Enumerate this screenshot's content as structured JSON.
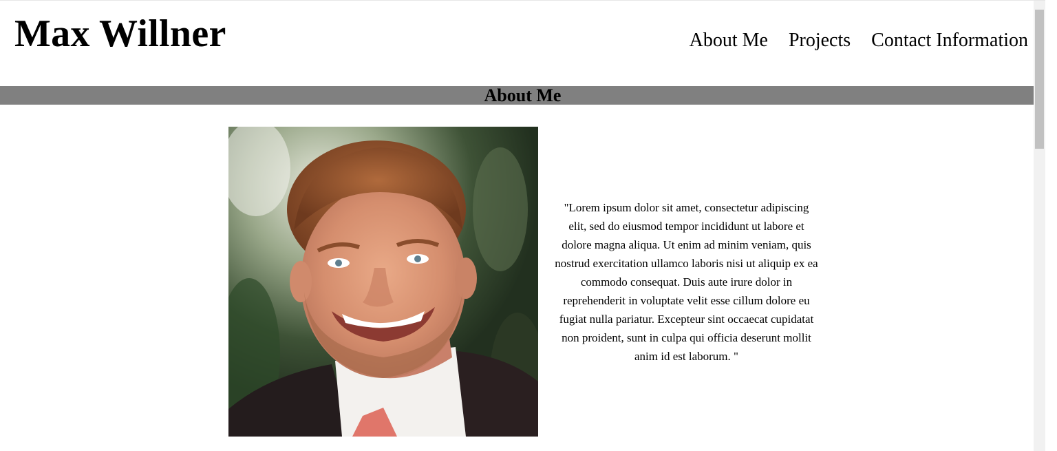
{
  "header": {
    "site_title": "Max Willner",
    "nav": [
      {
        "label": "About Me"
      },
      {
        "label": "Projects"
      },
      {
        "label": "Contact Information"
      }
    ]
  },
  "about": {
    "heading": "About Me",
    "photo_icon": "portrait-photo",
    "bio": "\"Lorem ipsum dolor sit amet, consectetur adipiscing elit, sed do eiusmod tempor incididunt ut labore et dolore magna aliqua. Ut enim ad minim veniam, quis nostrud exercitation ullamco laboris nisi ut aliquip ex ea commodo consequat. Duis aute irure dolor in reprehenderit in voluptate velit esse cillum dolore eu fugiat nulla pariatur. Excepteur sint occaecat cupidatat non proident, sunt in culpa qui officia deserunt mollit anim id est laborum. \""
  },
  "colors": {
    "section_bar": "#808080",
    "background": "#ffffff",
    "text": "#000000"
  }
}
